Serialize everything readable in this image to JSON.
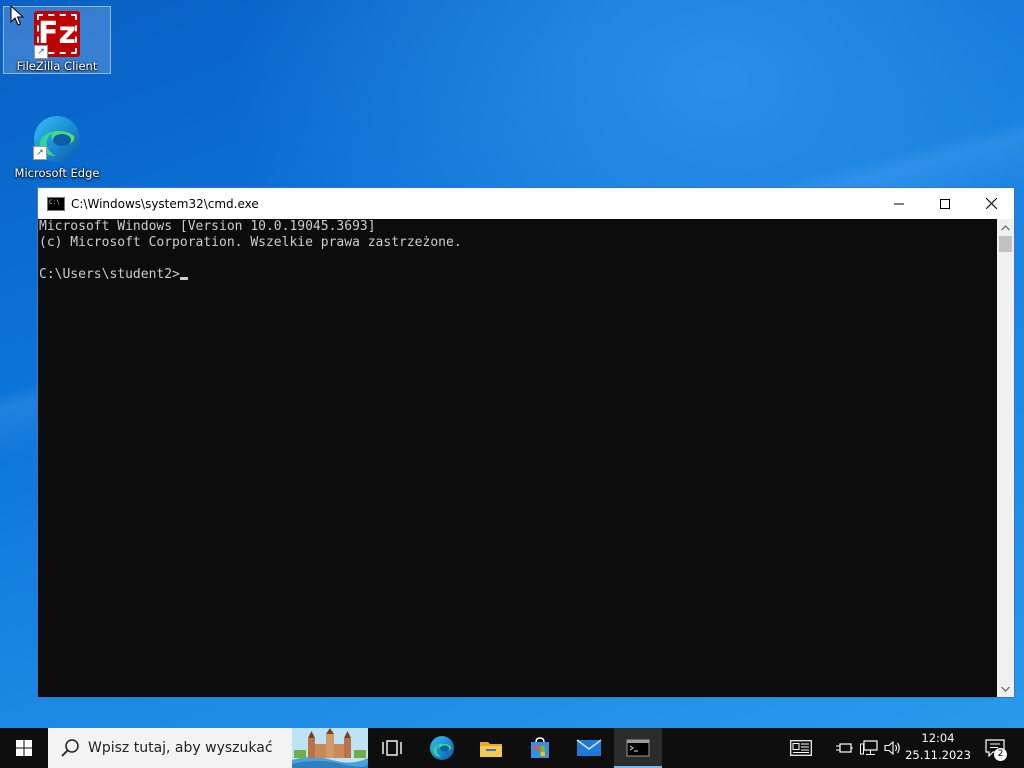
{
  "desktop": {
    "icons": [
      {
        "label": "FileZilla Client",
        "icon": "filezilla-icon"
      },
      {
        "label": "Microsoft Edge",
        "icon": "edge-icon"
      }
    ]
  },
  "window": {
    "title": "C:\\Windows\\system32\\cmd.exe",
    "console_lines": [
      "Microsoft Windows [Version 10.0.19045.3693]",
      "(c) Microsoft Corporation. Wszelkie prawa zastrzeżone.",
      "",
      "C:\\Users\\student2>"
    ]
  },
  "taskbar": {
    "search_placeholder": "Wpisz tutaj, aby wyszukać",
    "apps": [
      "task-view-icon",
      "edge-icon",
      "file-explorer-icon",
      "store-icon",
      "mail-icon",
      "cmd-icon"
    ],
    "time": "12:04",
    "date": "25.11.2023",
    "notification_count": "2"
  },
  "colors": {
    "accent": "#76b9ed",
    "console_bg": "#0c0c0c",
    "console_fg": "#cccccc",
    "taskbar_bg": "#0e0e0e"
  }
}
